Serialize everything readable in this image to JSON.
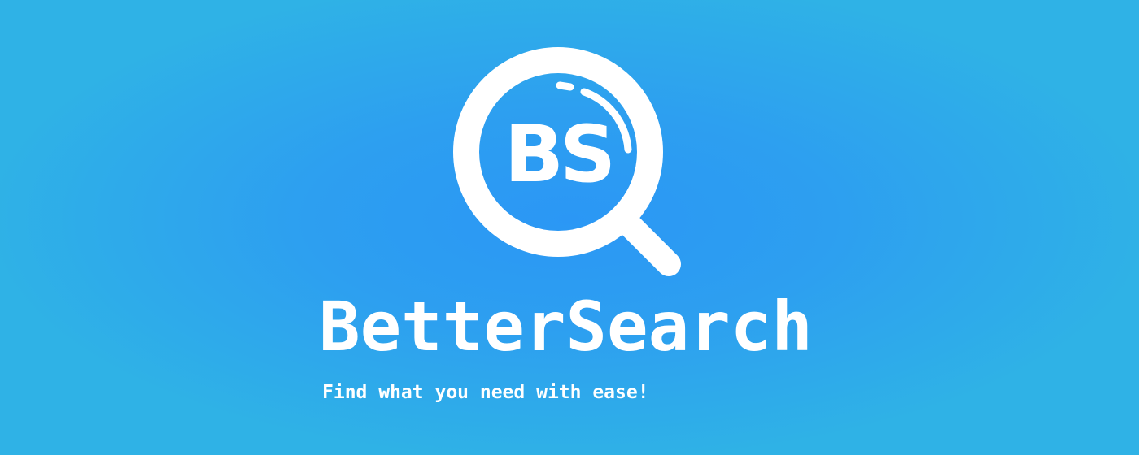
{
  "brand": {
    "monogram": "BS",
    "name": "BetterSearch",
    "tagline": "Find what you need with ease!"
  },
  "icons": {
    "logo": "magnifying-glass-icon"
  },
  "colors": {
    "background_center": "#2b97f5",
    "background_edge": "#2fb2e6",
    "foreground": "#ffffff"
  }
}
